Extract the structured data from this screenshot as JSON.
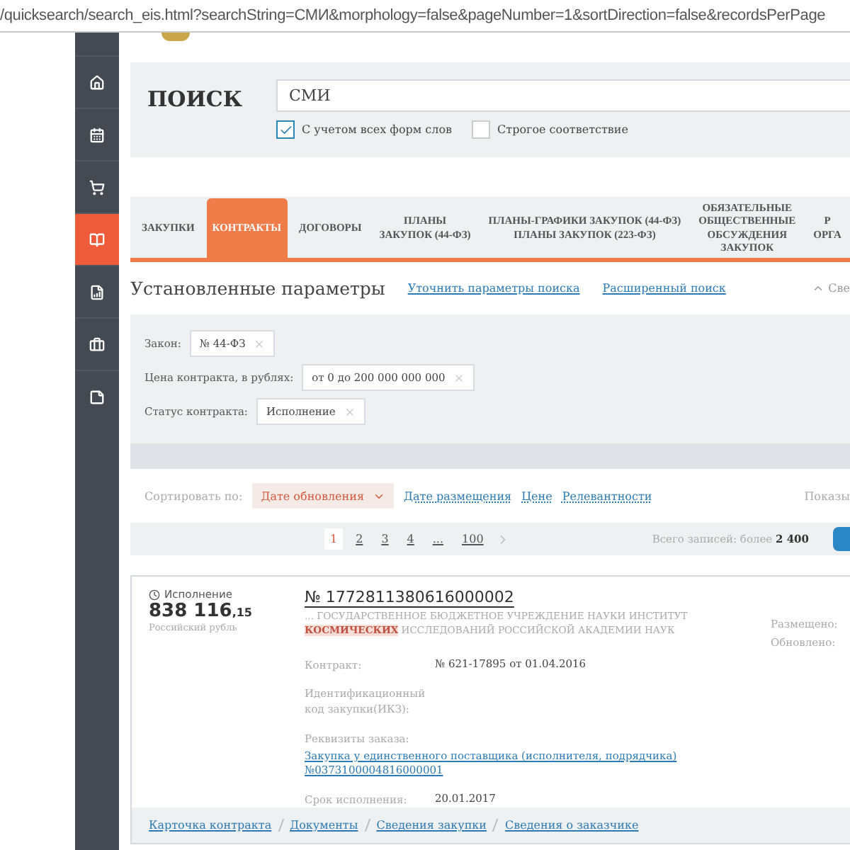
{
  "address_bar": {
    "url": "/quicksearch/search_eis.html?searchString=СМИ&morphology=false&pageNumber=1&sortDirection=false&recordsPerPage"
  },
  "sidebar": {
    "items": [
      {
        "selected": false
      },
      {
        "selected": false
      },
      {
        "selected": false
      },
      {
        "selected": true
      },
      {
        "selected": false
      },
      {
        "selected": false
      },
      {
        "selected": false
      }
    ]
  },
  "search": {
    "title": "ПОИСК",
    "value": "СМИ",
    "options": [
      {
        "label": "С учетом всех форм слов",
        "checked": true
      },
      {
        "label": "Строгое соответствие",
        "checked": false
      }
    ]
  },
  "tabs": [
    {
      "label": "ЗАКУПКИ",
      "selected": false
    },
    {
      "label": "КОНТРАКТЫ",
      "selected": true
    },
    {
      "label": "ДОГОВОРЫ",
      "selected": false
    },
    {
      "label": "ПЛАНЫ\nЗАКУПОК (44-ФЗ)",
      "selected": false
    },
    {
      "label": "ПЛАНЫ-ГРАФИКИ ЗАКУПОК (44-ФЗ)\nПЛАНЫ ЗАКУПОК (223-ФЗ)",
      "selected": false
    },
    {
      "label": "ОБЯЗАТЕЛЬНЫЕ\nОБЩЕСТВЕННЫЕ\nОБСУЖДЕНИЯ\nЗАКУПОК",
      "selected": false
    },
    {
      "label": "Р\nОРГА",
      "selected": false
    }
  ],
  "params": {
    "title": "Установленные параметры",
    "links": [
      "Уточнить параметры поиска",
      "Расширенный поиск"
    ],
    "collapse": "Све",
    "filters": [
      {
        "label": "Закон:",
        "value": "№ 44-ФЗ"
      },
      {
        "label": "Цена контракта, в рублях:",
        "value": "от 0 до 200 000 000 000"
      },
      {
        "label": "Статус контракта:",
        "value": "Исполнение"
      }
    ]
  },
  "sort": {
    "label": "Сортировать по:",
    "options": [
      {
        "label": "Дате обновления",
        "selected": true
      },
      {
        "label": "Дате размещения",
        "selected": false
      },
      {
        "label": "Цене",
        "selected": false
      },
      {
        "label": "Релевантности",
        "selected": false
      }
    ],
    "show": "Показы"
  },
  "pagination": {
    "pages": [
      {
        "label": "1",
        "selected": true
      },
      {
        "label": "2",
        "selected": false
      },
      {
        "label": "3",
        "selected": false
      },
      {
        "label": "4",
        "selected": false
      },
      {
        "label": "...",
        "selected": false
      },
      {
        "label": "100",
        "selected": false
      }
    ],
    "total": "Всего записей: более **2 400**"
  },
  "card": {
    "status": "Исполнение",
    "price": "838 116",
    "price_fraction": ",15",
    "currency": "Российский рубль",
    "number": "№ 1772811380616000002",
    "customer": "... ГОСУДАРСТВЕННОЕ БЮДЖЕТНОЕ УЧРЕЖДЕНИЕ НАУКИ ИНСТИТУТ **КОСМИЧЕСКИХ** ИССЛЕДОВАНИЙ РОССИЙСКОЙ АКАДЕМИИ НАУК",
    "dates": [
      "Размещено:",
      "Обновлено:"
    ],
    "fields": [
      {
        "kind": "text",
        "label": "Контракт:",
        "value": "№ 621-17895 от 01.04.2016"
      },
      {
        "kind": "empty",
        "label": "Идентификационный код закупки(ИКЗ):"
      },
      {
        "kind": "link",
        "label": "Реквизиты заказа:",
        "value": "Закупка у единственного поставщика (исполнителя, подрядчика) №0373100004816000001"
      },
      {
        "kind": "text",
        "label": "Срок исполнения:",
        "value": "20.01.2017"
      }
    ],
    "links": [
      "Карточка контракта",
      "Документы",
      "Сведения закупки",
      "Сведения о заказчике"
    ]
  }
}
